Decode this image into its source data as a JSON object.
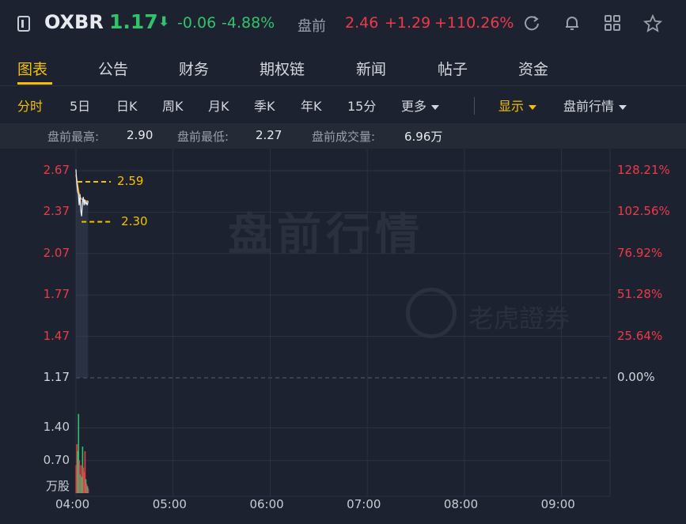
{
  "header": {
    "ticker": "OXBR",
    "price": "1.17",
    "change": "-0.06",
    "change_pct": "-4.88%",
    "premarket_label": "盘前",
    "premarket_price": "2.46",
    "premarket_change": "+1.29",
    "premarket_pct": "+110.26%",
    "icons": [
      "refresh-icon",
      "bell-icon",
      "grid-icon",
      "star-icon"
    ]
  },
  "tabs": [
    {
      "label": "图表",
      "active": true
    },
    {
      "label": "公告"
    },
    {
      "label": "财务"
    },
    {
      "label": "期权链"
    },
    {
      "label": "新闻"
    },
    {
      "label": "帖子"
    },
    {
      "label": "资金"
    }
  ],
  "subtabs": {
    "items": [
      "分时",
      "5日",
      "日K",
      "周K",
      "月K",
      "季K",
      "年K",
      "15分"
    ],
    "more": "更多",
    "display": "显示",
    "premarket_view": "盘前行情"
  },
  "stats": {
    "high_label": "盘前最高:",
    "high_value": "2.90",
    "low_label": "盘前最低:",
    "low_value": "2.27",
    "volume_label": "盘前成交量:",
    "volume_value": "6.96万"
  },
  "watermark": {
    "title": "盘前行情",
    "brand": "老虎證券"
  },
  "colors": {
    "up": "#ee3a48",
    "down": "#30c36b",
    "accent": "#f5c000",
    "background": "#1d2230"
  },
  "chart_data": {
    "type": "line",
    "y_ticks": [
      "2.67",
      "2.37",
      "2.07",
      "1.77",
      "1.47",
      "1.17"
    ],
    "y_tick_values": [
      2.67,
      2.37,
      2.07,
      1.77,
      1.47,
      1.17
    ],
    "pct_ticks": [
      "128.21%",
      "102.56%",
      "76.92%",
      "51.28%",
      "25.64%",
      "0.00%"
    ],
    "x_ticks": [
      "04:00",
      "05:00",
      "06:00",
      "07:00",
      "08:00",
      "09:00"
    ],
    "x_tick_values": [
      0,
      60,
      120,
      180,
      240,
      300
    ],
    "xlim": [
      0,
      330
    ],
    "ylim": [
      1.17,
      2.67
    ],
    "prev_close": 1.17,
    "marker_high": "2.59",
    "marker_low": "2.30",
    "price_series": [
      {
        "t": 0,
        "p": 2.68
      },
      {
        "t": 0.5,
        "p": 2.58
      },
      {
        "t": 1,
        "p": 2.52
      },
      {
        "t": 1.5,
        "p": 2.5
      },
      {
        "t": 2,
        "p": 2.42
      },
      {
        "t": 2.5,
        "p": 2.5
      },
      {
        "t": 3,
        "p": 2.38
      },
      {
        "t": 3.5,
        "p": 2.34
      },
      {
        "t": 4,
        "p": 2.44
      },
      {
        "t": 4.5,
        "p": 2.48
      },
      {
        "t": 5,
        "p": 2.42
      },
      {
        "t": 5.5,
        "p": 2.46
      },
      {
        "t": 6,
        "p": 2.43
      },
      {
        "t": 6.5,
        "p": 2.44
      },
      {
        "t": 7,
        "p": 2.42
      },
      {
        "t": 7.5,
        "p": 2.45
      }
    ],
    "avg_series": [
      {
        "t": 0,
        "p": 2.64
      },
      {
        "t": 1,
        "p": 2.57
      },
      {
        "t": 2,
        "p": 2.5
      },
      {
        "t": 3,
        "p": 2.47
      },
      {
        "t": 4,
        "p": 2.46
      },
      {
        "t": 5,
        "p": 2.46
      },
      {
        "t": 6,
        "p": 2.45
      },
      {
        "t": 7.5,
        "p": 2.45
      }
    ],
    "volume": {
      "unit_label": "万股",
      "ticks": [
        "1.40",
        "0.70"
      ],
      "tick_values": [
        1.4,
        0.7
      ],
      "ylim": [
        0,
        2.0
      ],
      "bars": [
        {
          "t": 0.0,
          "v": 0.6,
          "dir": "up"
        },
        {
          "t": 0.5,
          "v": 1.05,
          "dir": "up"
        },
        {
          "t": 1.0,
          "v": 0.9,
          "dir": "down"
        },
        {
          "t": 1.5,
          "v": 1.7,
          "dir": "down"
        },
        {
          "t": 2.0,
          "v": 0.7,
          "dir": "up"
        },
        {
          "t": 2.5,
          "v": 0.4,
          "dir": "down"
        },
        {
          "t": 3.0,
          "v": 0.6,
          "dir": "up"
        },
        {
          "t": 3.5,
          "v": 0.35,
          "dir": "down"
        },
        {
          "t": 4.0,
          "v": 1.0,
          "dir": "down"
        },
        {
          "t": 4.5,
          "v": 0.55,
          "dir": "up"
        },
        {
          "t": 5.0,
          "v": 0.45,
          "dir": "up"
        },
        {
          "t": 5.5,
          "v": 0.9,
          "dir": "up"
        },
        {
          "t": 6.0,
          "v": 0.3,
          "dir": "down"
        },
        {
          "t": 6.5,
          "v": 0.2,
          "dir": "up"
        },
        {
          "t": 7.0,
          "v": 0.15,
          "dir": "down"
        },
        {
          "t": 7.5,
          "v": 0.1,
          "dir": "up"
        }
      ]
    }
  }
}
